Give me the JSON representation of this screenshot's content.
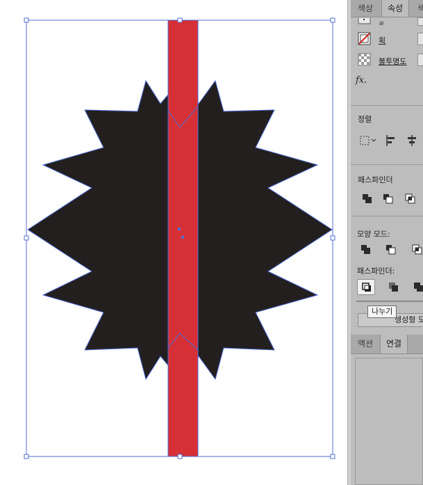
{
  "top_tabs": [
    {
      "label": "색상",
      "active": false
    },
    {
      "label": "속성",
      "active": true
    },
    {
      "label": "색",
      "active": false
    }
  ],
  "appearance": {
    "stroke_label": "획",
    "opacity_label": "불투명도",
    "fx_label": "fx."
  },
  "align": {
    "title": "정렬"
  },
  "pathfinder": {
    "title": "패스파인더",
    "shape_mode_label": "모양 모드:",
    "pathfinder_label": "패스파인더:",
    "tooltip": "나누기",
    "expand_button_label": "생성형 모"
  },
  "bottom_tabs": [
    {
      "label": "액션",
      "active": false
    },
    {
      "label": "연결",
      "active": true
    }
  ],
  "colors": {
    "star_fill": "#231f1e",
    "bar_fill": "#d63036",
    "selection": "#4f6cd6",
    "panel_bg": "#bdbdbd"
  }
}
